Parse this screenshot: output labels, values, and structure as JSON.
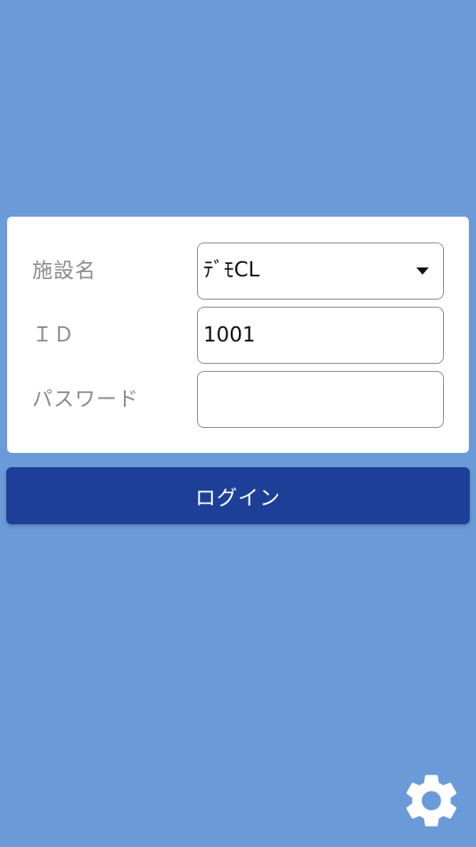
{
  "form": {
    "facility": {
      "label": "施設名",
      "value": "ﾃﾞﾓCL",
      "control": "select"
    },
    "id": {
      "label": "ＩＤ",
      "value": "1001"
    },
    "password": {
      "label": "パスワード",
      "value": ""
    }
  },
  "login_button": {
    "label": "ログイン"
  },
  "icons": {
    "settings": "gear-icon",
    "dropdown": "caret-down-icon"
  },
  "colors": {
    "background": "#6a9ad8",
    "card": "#ffffff",
    "button": "#1d3f98",
    "label_text": "#8c8c8c"
  }
}
